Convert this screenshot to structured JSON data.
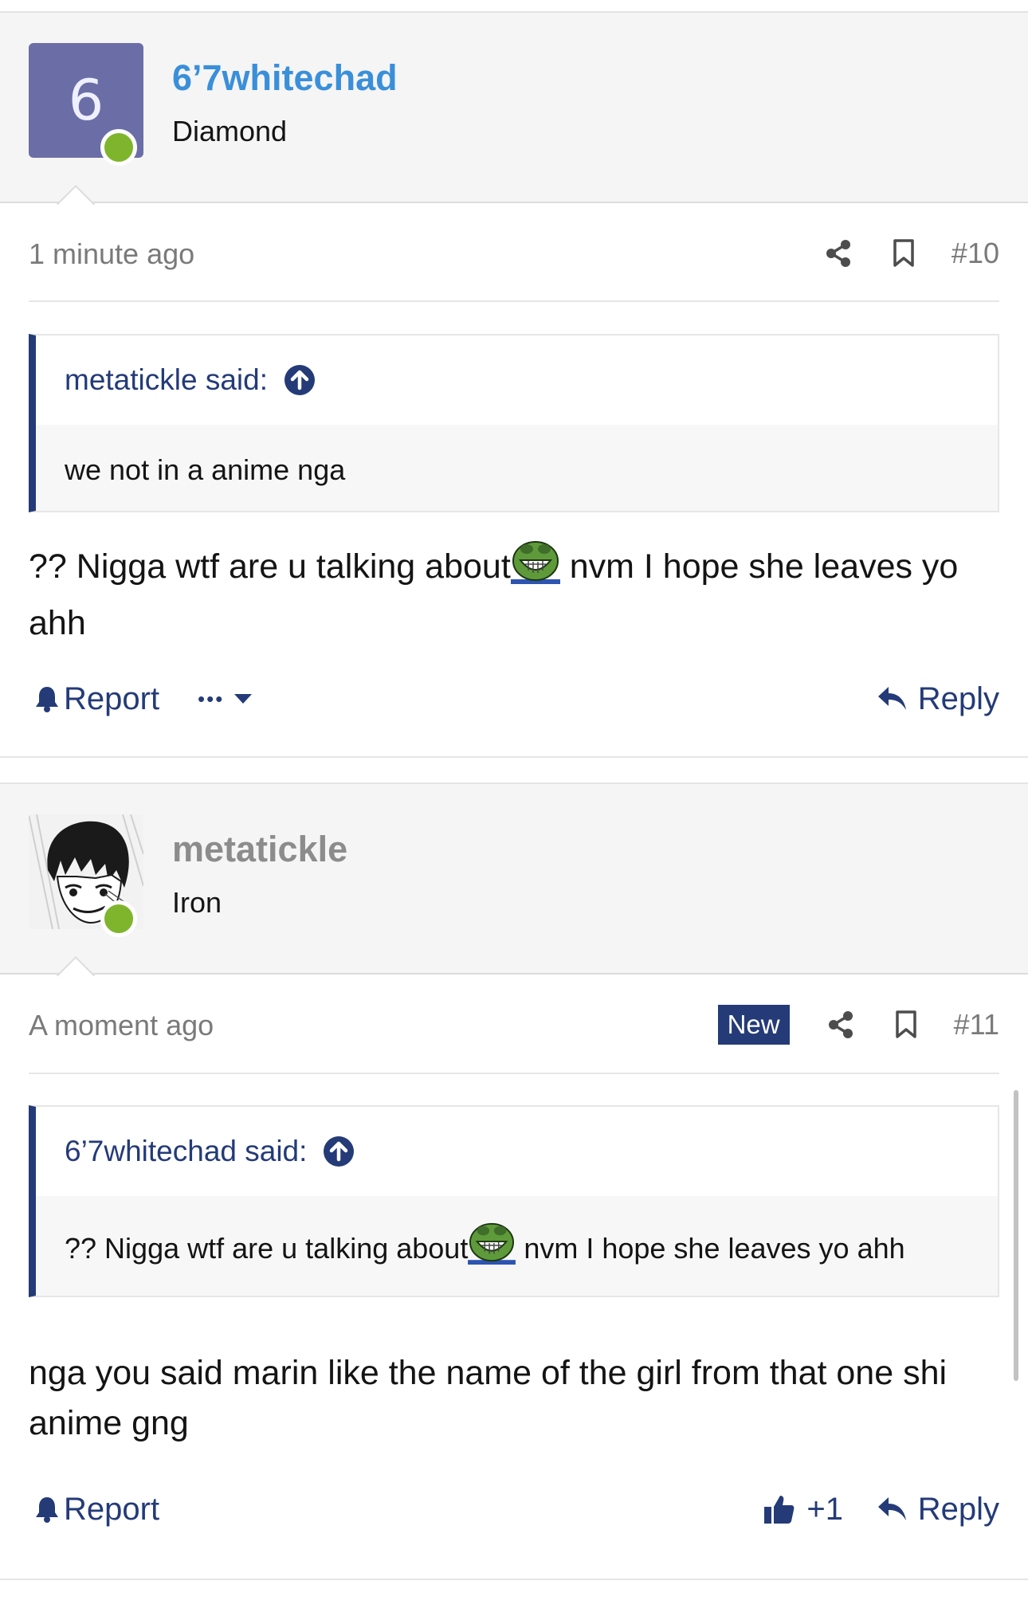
{
  "posts": [
    {
      "username": "6’7whitechad",
      "avatar_letter": "6",
      "rank": "Diamond",
      "time": "1 minute ago",
      "post_number": "#10",
      "new_badge": "",
      "quote": {
        "author_line": "metatickle said:",
        "text": "we not in a anime nga"
      },
      "message_before_emote": "?? Nigga wtf are u talking about",
      "emote": "laughing-pepe-emote",
      "message_after_emote": " nvm I hope she leaves yo ahh",
      "report_label": "Report",
      "reply_label": "Reply",
      "more_label": "•••"
    },
    {
      "username": "metatickle",
      "rank": "Iron",
      "time": "A moment ago",
      "post_number": "#11",
      "new_badge": "New",
      "quote": {
        "author_line": "6’7whitechad said:",
        "text_before_emote": "?? Nigga wtf are u talking about",
        "emote": "laughing-pepe-emote",
        "text_after_emote": " nvm I hope she leaves yo ahh"
      },
      "message": "nga you said marin like the name of the girl from that one shi anime gng",
      "report_label": "Report",
      "like_count": "+1",
      "reply_label": "Reply"
    }
  ],
  "colors": {
    "accent": "#243b78",
    "username_link": "#3a8fd9",
    "online": "#7fb52c",
    "avatar_bg": "#6b6ea6"
  }
}
